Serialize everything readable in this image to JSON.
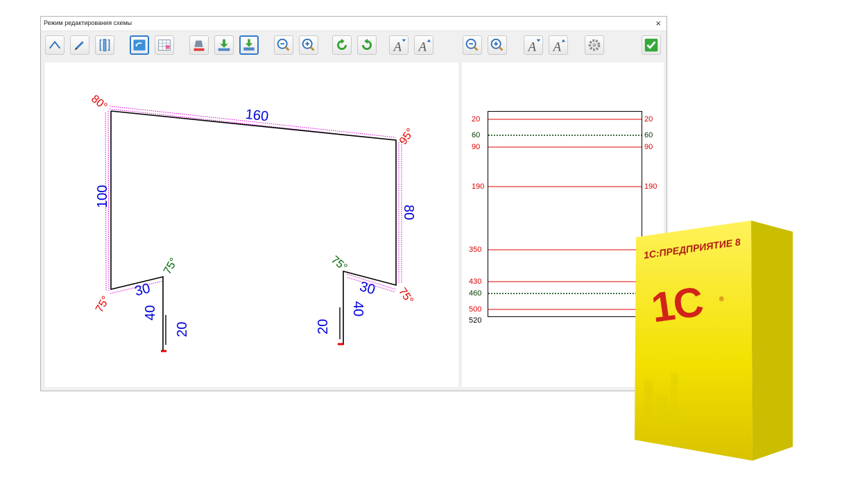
{
  "window": {
    "title": "Режим редактирования схемы",
    "close_glyph": "×"
  },
  "toolbar": {
    "buttons": [
      {
        "name": "bend-tool-button",
        "icon": "angle-icon"
      },
      {
        "name": "pencil-tool-button",
        "icon": "pencil-icon"
      },
      {
        "name": "measure-tool-button",
        "icon": "ruler-bracket-icon"
      },
      {
        "name": "undo-shape-button",
        "icon": "undo-icon",
        "active": true
      },
      {
        "name": "grid-table-button",
        "icon": "grid-icon"
      },
      {
        "name": "fill-color-button",
        "icon": "fill-bucket-icon"
      },
      {
        "name": "download-bottom-button",
        "icon": "download-icon"
      },
      {
        "name": "download-frame-button",
        "icon": "download-frame-icon",
        "active": true
      },
      {
        "name": "zoom-out-left-button",
        "icon": "zoom-out-icon"
      },
      {
        "name": "zoom-in-left-button",
        "icon": "zoom-in-icon"
      },
      {
        "name": "rotate-ccw-button",
        "icon": "rotate-ccw-icon"
      },
      {
        "name": "rotate-cw-button",
        "icon": "rotate-cw-icon"
      },
      {
        "name": "font-decrease-left-button",
        "icon": "font-decrease-icon"
      },
      {
        "name": "font-increase-left-button",
        "icon": "font-increase-icon"
      },
      {
        "name": "zoom-out-right-button",
        "icon": "zoom-out-icon"
      },
      {
        "name": "zoom-in-right-button",
        "icon": "zoom-in-icon"
      },
      {
        "name": "font-decrease-right-button",
        "icon": "font-decrease-icon"
      },
      {
        "name": "font-increase-right-button",
        "icon": "font-increase-icon"
      },
      {
        "name": "settings-button",
        "icon": "gear-icon"
      },
      {
        "name": "confirm-button",
        "icon": "checkmark-icon"
      }
    ]
  },
  "profile": {
    "segments": [
      {
        "value": "160",
        "color": "#0000dd"
      },
      {
        "value": "100",
        "color": "#0000dd"
      },
      {
        "value": "80",
        "color": "#0000dd"
      },
      {
        "value": "30",
        "color": "#0000dd"
      },
      {
        "value": "40",
        "color": "#0000dd"
      },
      {
        "value": "20",
        "color": "#0000dd"
      },
      {
        "value": "30",
        "color": "#0000dd"
      },
      {
        "value": "40",
        "color": "#0000dd"
      },
      {
        "value": "20",
        "color": "#0000dd"
      }
    ],
    "angles": [
      {
        "value": "80°",
        "color": "#e00000"
      },
      {
        "value": "95°",
        "color": "#e00000"
      },
      {
        "value": "75°",
        "color": "#e00000"
      },
      {
        "value": "75°",
        "color": "#e00000"
      },
      {
        "value": "75°",
        "color": "#006400"
      },
      {
        "value": "75°",
        "color": "#006400"
      }
    ]
  },
  "ruler": {
    "rows": [
      {
        "left": "20",
        "right": "20",
        "style": "red-solid"
      },
      {
        "left": "60",
        "right": "60",
        "style": "green-dotted"
      },
      {
        "left": "90",
        "right": "90",
        "style": "red-solid"
      },
      {
        "left": "190",
        "right": "190",
        "style": "red-solid"
      },
      {
        "left": "350",
        "right": "",
        "style": "red-solid"
      },
      {
        "left": "430",
        "right": "",
        "style": "red-solid"
      },
      {
        "left": "460",
        "right": "",
        "style": "green-dotted"
      },
      {
        "left": "500",
        "right": "",
        "style": "red-solid"
      },
      {
        "left": "520",
        "right": "",
        "style": "black-edge"
      }
    ]
  },
  "product_box": {
    "title": "1С:ПРЕДПРИЯТИЕ 8",
    "logo": "1С",
    "registered": "®"
  },
  "colors": {
    "accent": "#2f7bd0",
    "dimension": "#0000dd",
    "angle": "#e00000",
    "angle_alt": "#006400",
    "marker": "#e000e0",
    "box_yellow": "#f2e000"
  }
}
